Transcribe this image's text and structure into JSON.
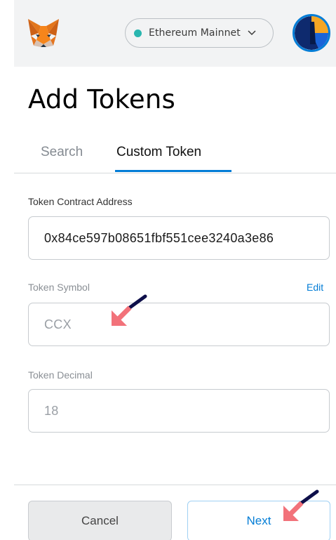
{
  "header": {
    "network_label": "Ethereum Mainnet",
    "network_status_color": "#29b6af",
    "logo_icon": "metamask-fox-icon",
    "avatar_icon": "account-avatar-icon",
    "chevron_icon": "chevron-down-icon"
  },
  "page": {
    "title": "Add Tokens"
  },
  "tabs": [
    {
      "label": "Search",
      "active": false
    },
    {
      "label": "Custom Token",
      "active": true
    }
  ],
  "form": {
    "contract_address": {
      "label": "Token Contract Address",
      "value": "0x84ce597b08651fbf551cee3240a3e86"
    },
    "symbol": {
      "label": "Token Symbol",
      "edit_label": "Edit",
      "value": "CCX"
    },
    "decimal": {
      "label": "Token Decimal",
      "value": "18"
    }
  },
  "footer": {
    "cancel_label": "Cancel",
    "next_label": "Next"
  },
  "colors": {
    "accent": "#037dd6",
    "arrow": "#f2727a",
    "arrow_tail": "#0e0f4a"
  }
}
